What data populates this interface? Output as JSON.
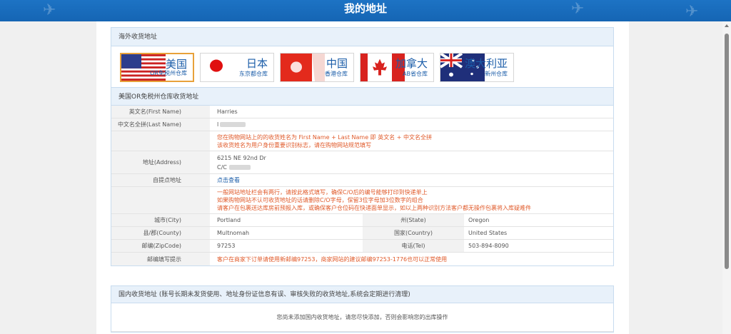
{
  "header": {
    "title": "我的地址"
  },
  "overseas": {
    "title": "海外收货地址",
    "warehouses": [
      {
        "country": "美国",
        "warehouse": "OR免税州仓库",
        "active": true
      },
      {
        "country": "日本",
        "warehouse": "东京都仓库",
        "active": false
      },
      {
        "country": "中国",
        "warehouse": "香港仓库",
        "active": false
      },
      {
        "country": "加拿大",
        "warehouse": "AB省仓库",
        "active": false
      },
      {
        "country": "澳大利亚",
        "warehouse": "新州仓库",
        "active": false
      }
    ],
    "address_title": "美国OR免税州仓库收货地址",
    "first_name_label": "英文名(First Name)",
    "first_name_value": "Harries",
    "last_name_label": "中文名全拼(Last Name)",
    "last_name_value": "l",
    "name_note_1": "您在购物网站上的的收货姓名为 First Name + Last Name 即 英文名 + 中文名全拼",
    "name_note_2": "该收货姓名为用户身份重要识别标志，请在购物网站规范填写",
    "address_label": "地址(Address)",
    "address_line1": "6215 NE 92nd Dr",
    "address_line2": "C/C",
    "pickup_label": "自提点地址",
    "pickup_link": "点击查看",
    "addr_note_1": "一般网站地址栏会有两行，请按此格式填写，确保C/O后的编号能够打印到快递单上",
    "addr_note_2": "如果购物网站不认可收货地址的话请删除C/O字母，保留3位字母加3位数字的组合",
    "addr_note_3": "请客户在包裹送达库房前预报入库，或确保客户仓位码在快递面单显示，如以上两种识别方法客户都无操作包裹将入库疑难件",
    "city_label": "城市(City)",
    "city_value": "Portland",
    "state_label": "州(State)",
    "state_value": "Oregon",
    "county_label": "县/郡(County)",
    "county_value": "Multnomah",
    "country_label": "国家(Country)",
    "country_value": "United States",
    "zip_label": "邮编(ZipCode)",
    "zip_value": "97253",
    "tel_label": "电话(Tel)",
    "tel_value": "503-894-8090",
    "zip_tip_label": "邮编填写提示",
    "zip_tip_value": "客户在商家下订单请使用新邮编97253，商家网站的建议邮编97253-1776也可以正常使用"
  },
  "domestic": {
    "title": "国内收货地址 (账号长期未发货使用、地址身份证信息有误、审核失败的收货地址,系统会定期进行清理)",
    "empty_message": "您尚未添加国内收货地址，请您尽快添加，否则会影响您的出库操作"
  },
  "colors": {
    "header": "#1565b4",
    "accent": "#e05a2a",
    "link": "#1a5ca8",
    "active_border": "#e8a13a"
  }
}
